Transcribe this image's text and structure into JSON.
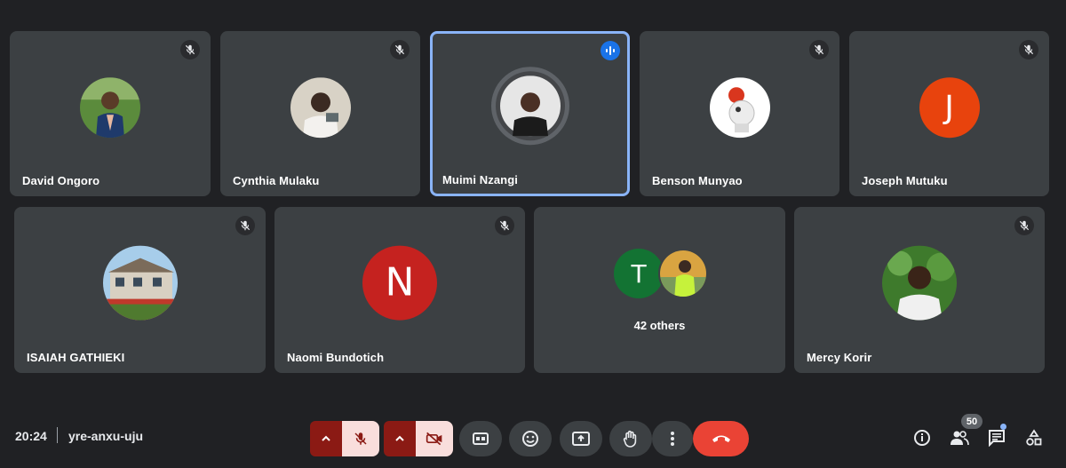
{
  "participants_row1": [
    {
      "name": "David Ongoro",
      "muted": true
    },
    {
      "name": "Cynthia Mulaku",
      "muted": true
    },
    {
      "name": "Muimi Nzangi",
      "speaking": true
    },
    {
      "name": "Benson Munyao",
      "muted": true
    },
    {
      "name": "Joseph Mutuku",
      "muted": true,
      "avatar_letter": "J",
      "avatar_color": "#e8430d"
    }
  ],
  "participants_row2": [
    {
      "name": "ISAIAH GATHIEKI",
      "muted": true
    },
    {
      "name": "Naomi Bundotich",
      "muted": true,
      "avatar_letter": "N",
      "avatar_color": "#c5221f"
    },
    {
      "others_label": "42 others",
      "letter": "T",
      "letter_color": "#137333"
    },
    {
      "name": "Mercy Korir",
      "muted": true
    }
  ],
  "bottom": {
    "time": "20:24",
    "meeting_code": "yre-anxu-uju",
    "participant_count": "50"
  },
  "colors": {
    "background": "#202124",
    "tile": "#3c4043",
    "active_border": "#8ab4f8",
    "end_call": "#ea4335"
  }
}
